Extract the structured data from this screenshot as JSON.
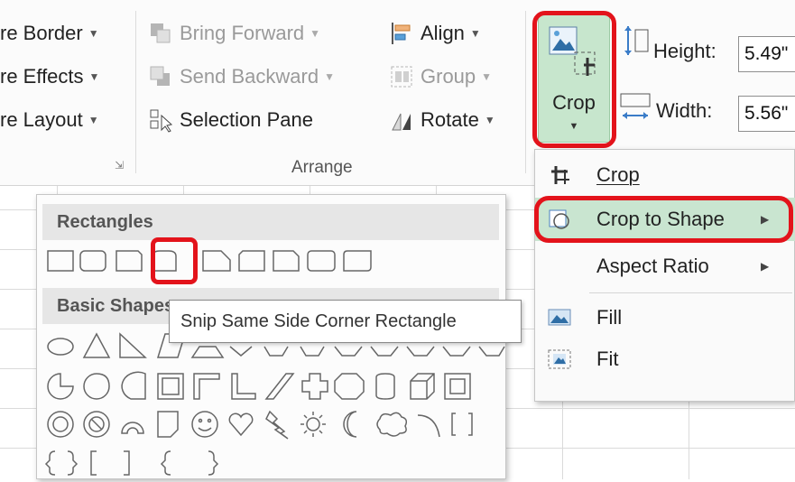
{
  "ribbon": {
    "picture_group": {
      "border_label": "re Border",
      "effects_label": "re Effects",
      "layout_label": "re Layout"
    },
    "arrange_group": {
      "bring_forward": "Bring Forward",
      "send_backward": "Send Backward",
      "selection_pane": "Selection Pane",
      "align": "Align",
      "group": "Group",
      "rotate": "Rotate",
      "group_label": "Arrange"
    },
    "size_group": {
      "crop_label": "Crop",
      "height_label": "Height:",
      "height_value": "5.49\"",
      "width_label": "Width:",
      "width_value": "5.56\""
    }
  },
  "crop_menu": {
    "items": [
      {
        "label": "Crop",
        "icon": "crop-icon",
        "submenu": false
      },
      {
        "label": "Crop to Shape",
        "icon": "crop-to-shape-icon",
        "submenu": true
      },
      {
        "label": "Aspect Ratio",
        "icon": "",
        "submenu": true
      },
      {
        "label": "Fill",
        "icon": "fill-icon",
        "submenu": false
      },
      {
        "label": "Fit",
        "icon": "fit-icon",
        "submenu": false
      }
    ],
    "highlighted_item": "Crop to Shape"
  },
  "shape_gallery": {
    "sections": [
      {
        "title": "Rectangles"
      },
      {
        "title": "Basic Shapes"
      }
    ],
    "tooltip": "Snip Same Side Corner Rectangle"
  },
  "colors": {
    "highlight_red": "#e3131b",
    "selected_green": "#c7e6cd",
    "ribbon_bg": "#fbfbfb"
  }
}
